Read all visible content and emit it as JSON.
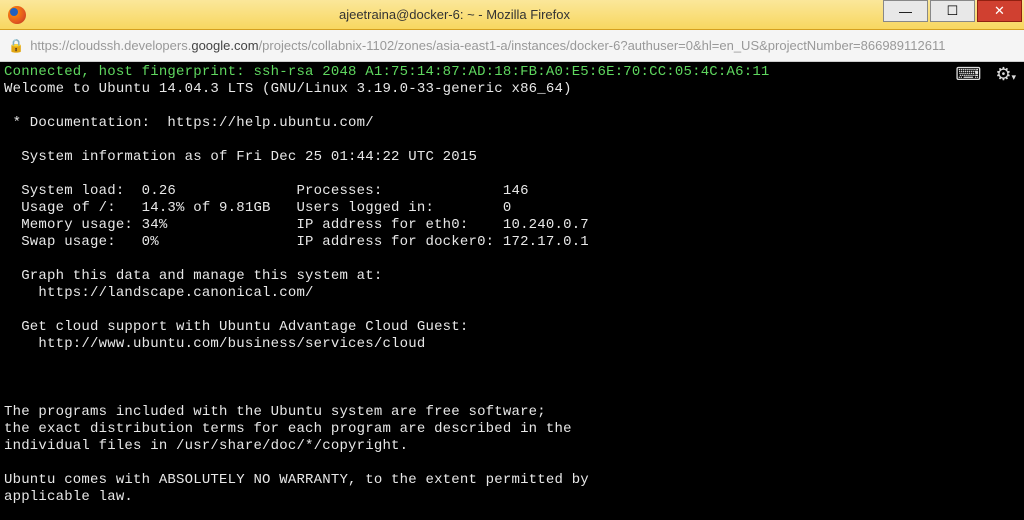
{
  "window": {
    "title": "ajeetraina@docker-6: ~ - Mozilla Firefox",
    "minimize": "—",
    "maximize": "☐",
    "close": "✕"
  },
  "url": {
    "scheme": "https://cloudssh.developers.",
    "host": "google.com",
    "path": "/projects/collabnix-1102/zones/asia-east1-a/instances/docker-6?authuser=0&hl=en_US&projectNumber=866989112611"
  },
  "terminal": {
    "line_green": "Connected, host fingerprint: ssh-rsa 2048 A1:75:14:87:AD:18:FB:A0:E5:6E:70:CC:05:4C:A6:11",
    "welcome": "Welcome to Ubuntu 14.04.3 LTS (GNU/Linux 3.19.0-33-generic x86_64)",
    "doc": " * Documentation:  https://help.ubuntu.com/",
    "sysinfo_header": "  System information as of Fri Dec 25 01:44:22 UTC 2015",
    "row1": "  System load:  0.26              Processes:              146",
    "row2": "  Usage of /:   14.3% of 9.81GB   Users logged in:        0",
    "row3": "  Memory usage: 34%               IP address for eth0:    10.240.0.7",
    "row4": "  Swap usage:   0%                IP address for docker0: 172.17.0.1",
    "graph1": "  Graph this data and manage this system at:",
    "graph2": "    https://landscape.canonical.com/",
    "cloud1": "  Get cloud support with Ubuntu Advantage Cloud Guest:",
    "cloud2": "    http://www.ubuntu.com/business/services/cloud",
    "prog1": "The programs included with the Ubuntu system are free software;",
    "prog2": "the exact distribution terms for each program are described in the",
    "prog3": "individual files in /usr/share/doc/*/copyright.",
    "warr1": "Ubuntu comes with ABSOLUTELY NO WARRANTY, to the extent permitted by",
    "warr2": "applicable law."
  }
}
